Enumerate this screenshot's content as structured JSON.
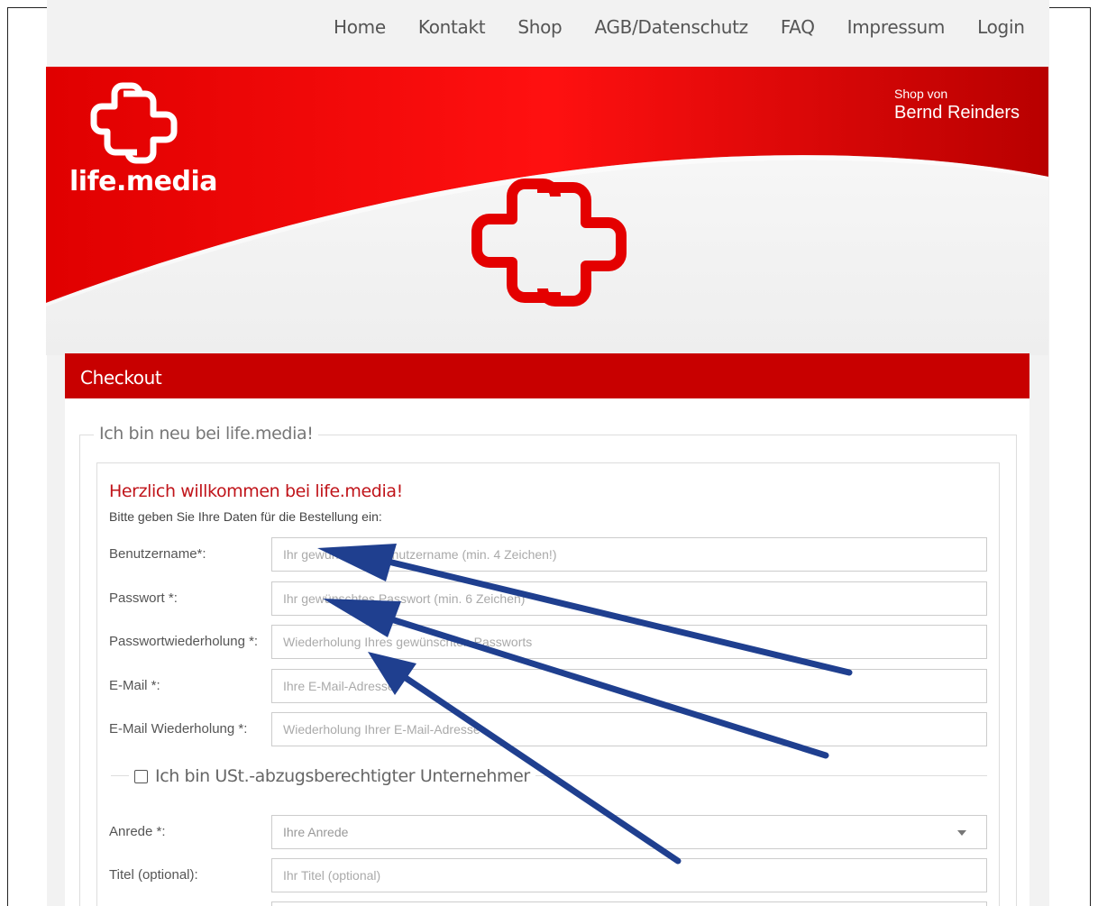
{
  "nav": {
    "items": [
      "Home",
      "Kontakt",
      "Shop",
      "AGB/Datenschutz",
      "FAQ",
      "Impressum",
      "Login"
    ]
  },
  "banner": {
    "brand": "life.media",
    "shop_by_label": "Shop von",
    "shop_owner": "Bernd Reinders"
  },
  "checkout": {
    "title": "Checkout",
    "section_legend": "Ich bin neu bei life.media!",
    "welcome": "Herzlich willkommen bei life.media!",
    "intro": "Bitte geben Sie Ihre Daten für die Bestellung ein:",
    "fields": [
      {
        "label": "Benutzername*:",
        "placeholder": "Ihr gewünschter Benutzername (min. 4 Zeichen!)"
      },
      {
        "label": "Passwort *:",
        "placeholder": "Ihr gewünschtes Passwort (min. 6 Zeichen)"
      },
      {
        "label": "Passwortwiederholung *:",
        "placeholder": "Wiederholung Ihres gewünschten Passworts"
      },
      {
        "label": "E-Mail *:",
        "placeholder": "Ihre E-Mail-Adresse"
      },
      {
        "label": "E-Mail Wiederholung *:",
        "placeholder": "Wiederholung Ihrer E-Mail-Adresse"
      }
    ],
    "company_checkbox_label": "Ich bin USt.-abzugsberechtigter Unternehmer",
    "salutation": {
      "label": "Anrede *:",
      "placeholder": "Ihre Anrede"
    },
    "title_field": {
      "label": "Titel (optional):",
      "placeholder": "Ihr Titel (optional)"
    }
  },
  "colors": {
    "brand_red": "#c80000",
    "welcome_red": "#c0141a",
    "arrow_blue": "#1f3f8f"
  },
  "icons": [
    "logo-cross-icon",
    "dropdown-caret-icon",
    "checkbox-icon"
  ]
}
